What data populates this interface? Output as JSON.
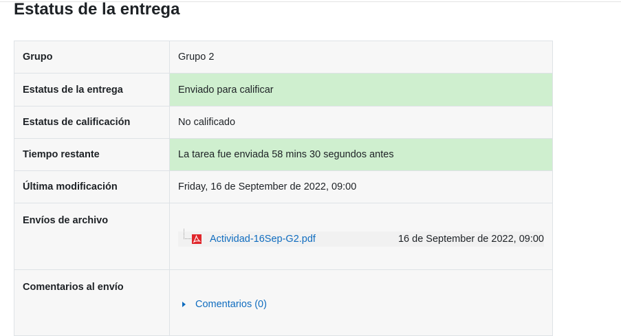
{
  "page": {
    "title": "Estatus de la entrega"
  },
  "rows": {
    "group": {
      "label": "Grupo",
      "value": "Grupo 2"
    },
    "submission_status": {
      "label": "Estatus de la entrega",
      "value": "Enviado para calificar"
    },
    "grading_status": {
      "label": "Estatus de calificación",
      "value": "No calificado"
    },
    "time_remaining": {
      "label": "Tiempo restante",
      "value": "La tarea fue enviada 58 mins 30 segundos antes"
    },
    "last_modified": {
      "label": "Última modificación",
      "value": "Friday, 16 de September de 2022, 09:00"
    },
    "file_submissions": {
      "label": "Envíos de archivo",
      "file_name": "Actividad-16Sep-G2.pdf",
      "file_date": "16 de September de 2022, 09:00",
      "file_icon": "pdf-icon"
    },
    "submission_comments": {
      "label": "Comentarios al envío",
      "link": "Comentarios (0)",
      "icon": "caret-right-icon"
    }
  },
  "colors": {
    "success_bg": "#cfefcf",
    "cell_bg": "#f7f7f7",
    "link": "#0f6cbf",
    "pdf_red": "#e0262b"
  }
}
